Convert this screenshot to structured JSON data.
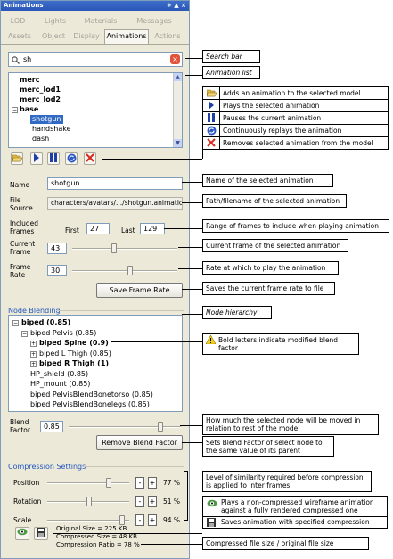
{
  "window": {
    "title": "Animations",
    "buttons": "+ ▲ ×"
  },
  "tabs": {
    "row1": [
      "LOD",
      "Lights",
      "Materials",
      "Messages"
    ],
    "row2": [
      "Assets",
      "Object",
      "Display",
      "Animations",
      "Actions"
    ],
    "active": "Animations"
  },
  "search": {
    "value": "sh"
  },
  "animation_list": [
    {
      "label": "merc",
      "bold": true,
      "indent": 0
    },
    {
      "label": "merc_lod1",
      "bold": true,
      "indent": 0
    },
    {
      "label": "merc_lod2",
      "bold": true,
      "indent": 0
    },
    {
      "label": "base",
      "bold": true,
      "indent": 0,
      "expander": "−"
    },
    {
      "label": "shotgun",
      "bold": false,
      "indent": 1,
      "selected": true
    },
    {
      "label": "handshake",
      "bold": false,
      "indent": 1
    },
    {
      "label": "dash",
      "bold": false,
      "indent": 1
    }
  ],
  "form": {
    "name_label": "Name",
    "name_value": "shotgun",
    "file_label": "File\nSource",
    "file_value": "characters/avatars/.../shotgun.animation",
    "included_label": "Included\nFrames",
    "first_label": "First",
    "first_value": "27",
    "last_label": "Last",
    "last_value": "129",
    "current_label": "Current\nFrame",
    "current_value": "43",
    "current_fraction": 0.4,
    "rate_label": "Frame\nRate",
    "rate_value": "30",
    "rate_fraction": 0.56,
    "save_rate_button": "Save Frame Rate"
  },
  "node_blending": {
    "title": "Node Blending",
    "nodes": [
      {
        "label": "biped (0.85)",
        "bold": true,
        "indent": 0,
        "expander": "−"
      },
      {
        "label": "biped Pelvis (0.85)",
        "bold": false,
        "indent": 1,
        "expander": "−"
      },
      {
        "label": "biped Spine (0.9)",
        "bold": true,
        "indent": 2,
        "expander": "+"
      },
      {
        "label": "biped L Thigh (0.85)",
        "bold": false,
        "indent": 2,
        "expander": "+"
      },
      {
        "label": "biped R Thigh (1)",
        "bold": true,
        "indent": 2,
        "expander": "+"
      },
      {
        "label": "HP_shield (0.85)",
        "bold": false,
        "indent": 2
      },
      {
        "label": "HP_mount (0.85)",
        "bold": false,
        "indent": 2
      },
      {
        "label": "biped PelvisBlendBonetorso (0.85)",
        "bold": false,
        "indent": 2
      },
      {
        "label": "biped PelvisBlendBonelegs (0.85)",
        "bold": false,
        "indent": 2
      }
    ],
    "factor_label": "Blend\nFactor",
    "factor_value": "0.85",
    "factor_fraction": 0.85,
    "remove_button": "Remove Blend Factor"
  },
  "compression": {
    "title": "Compression Settings",
    "rows": [
      {
        "label": "Position",
        "value": "77 %",
        "fraction": 0.77
      },
      {
        "label": "Rotation",
        "value": "51 %",
        "fraction": 0.51
      },
      {
        "label": "Scale",
        "value": "94 %",
        "fraction": 0.94
      }
    ],
    "minus": "-",
    "plus": "+",
    "original": "Original Size = 225 KB",
    "compressed": "Compressed Size = 48 KB",
    "ratio": "Compression Ratio = 78 %"
  },
  "callouts": {
    "search": "Search bar",
    "list": "Animation list",
    "legend": [
      {
        "icon": "folder-open-icon",
        "text": "Adds an animation to the selected model"
      },
      {
        "icon": "play-icon",
        "text": "Plays the selected animation"
      },
      {
        "icon": "pause-icon",
        "text": "Pauses the current animation"
      },
      {
        "icon": "loop-icon",
        "text": "Continuously replays the animation"
      },
      {
        "icon": "remove-x-icon",
        "text": "Removes selected animation from the  model"
      }
    ],
    "name": "Name of the selected animation",
    "file": "Path/filename of the selected animation",
    "range": "Range of frames to include when playing animation",
    "current": "Current frame of the selected animation",
    "rate": "Rate at which to play the animation",
    "save_rate": "Saves the current frame rate to file",
    "hierarchy": "Node hierarchy",
    "bold": "Bold letters indicate modified blend factor",
    "blend": "How much the selected node will be moved in relation to rest of the model",
    "remove": "Sets Blend Factor of select node to  the same value of its parent",
    "similarity": "Level of similarity required before compression is applied to inter frames",
    "wireframe": "Plays a non-compressed wireframe animation against a fully rendered compressed one",
    "save_comp": "Saves animation with specified compression",
    "size": "Compressed file size / original file size"
  },
  "colors": {
    "accent": "#2a57b8",
    "selection": "#316ac5",
    "group": "#1f56c1"
  }
}
